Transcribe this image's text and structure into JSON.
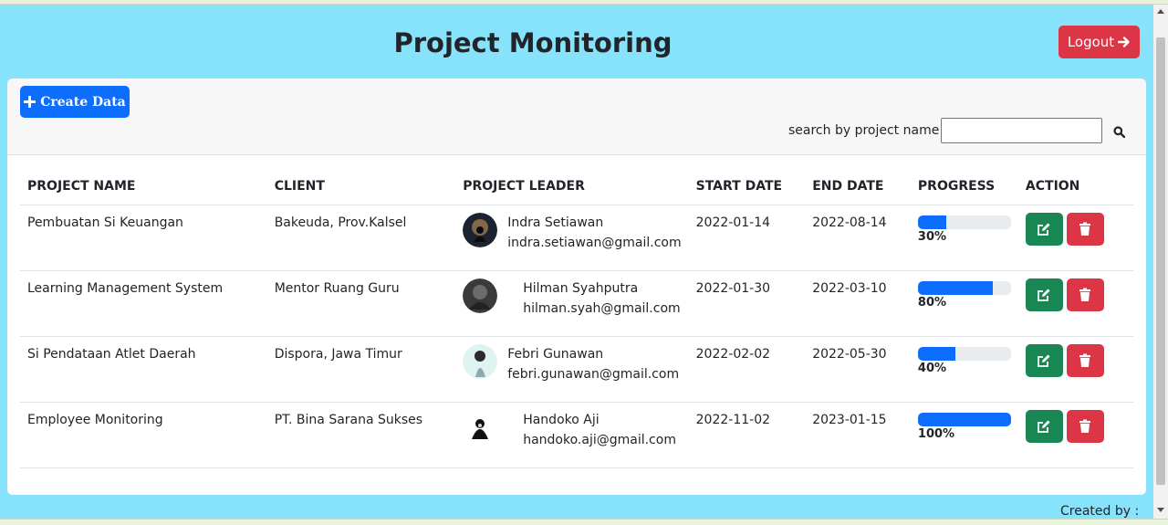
{
  "header": {
    "title": "Project Monitoring",
    "logout_label": "Logout"
  },
  "toolbar": {
    "create_label": "Create Data",
    "search_label": "search by project name :",
    "search_value": ""
  },
  "table": {
    "columns": [
      "PROJECT NAME",
      "CLIENT",
      "PROJECT LEADER",
      "START DATE",
      "END DATE",
      "PROGRESS",
      "ACTION"
    ],
    "rows": [
      {
        "project": "Pembuatan Si Keuangan",
        "client": "Bakeuda, Prov.Kalsel",
        "leader": "Indra Setiawan",
        "email": "indra.setiawan@gmail.com",
        "start": "2022-01-14",
        "end": "2022-08-14",
        "progress": 30,
        "progress_label": "30%"
      },
      {
        "project": "Learning Management System",
        "client": "Mentor Ruang Guru",
        "leader": "Hilman Syahputra",
        "email": "hilman.syah@gmail.com",
        "start": "2022-01-30",
        "end": "2022-03-10",
        "progress": 80,
        "progress_label": "80%"
      },
      {
        "project": "Si Pendataan Atlet Daerah",
        "client": "Dispora, Jawa Timur",
        "leader": "Febri Gunawan",
        "email": "febri.gunawan@gmail.com",
        "start": "2022-02-02",
        "end": "2022-05-30",
        "progress": 40,
        "progress_label": "40%"
      },
      {
        "project": "Employee Monitoring",
        "client": "PT. Bina Sarana Sukses",
        "leader": "Handoko Aji",
        "email": "handoko.aji@gmail.com",
        "start": "2022-11-02",
        "end": "2023-01-15",
        "progress": 100,
        "progress_label": "100%"
      }
    ]
  },
  "footer": {
    "text": "Created by :"
  },
  "colors": {
    "background": "#87e3fb",
    "primary": "#0d6efd",
    "danger": "#dc3545",
    "success": "#198754"
  },
  "icons": {
    "create": "plus-icon",
    "logout": "arrow-right-icon",
    "search": "search-icon",
    "edit": "edit-icon",
    "delete": "trash-icon"
  }
}
